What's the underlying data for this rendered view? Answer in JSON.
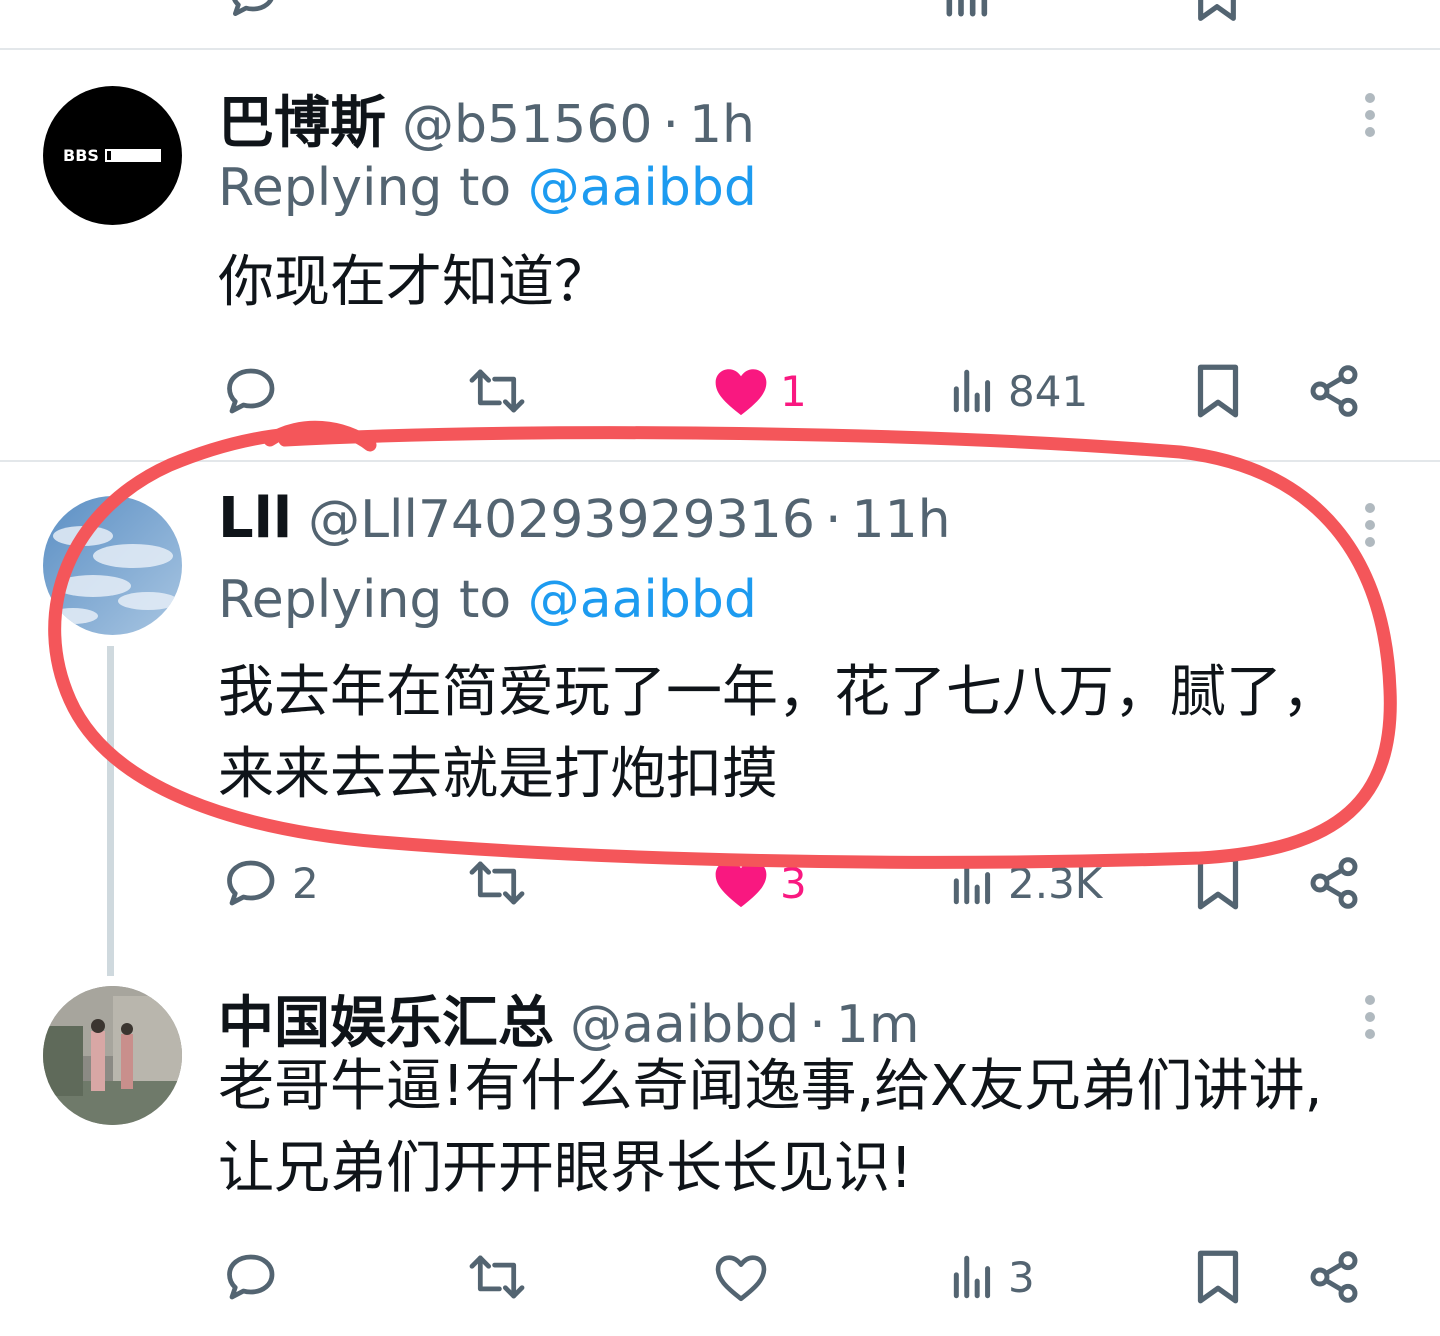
{
  "tweets": [
    {
      "name": "巴博斯",
      "handle": "@b51560",
      "time": "1h",
      "replying_prefix": "Replying to",
      "replying_handle": "@aaibbd",
      "text": "你现在才知道？",
      "likes": "1",
      "views": "841",
      "avatar_text": "BBS"
    },
    {
      "name": "Lll",
      "handle": "@Lll740293929316",
      "time": "11h",
      "replying_prefix": "Replying to",
      "replying_handle": "@aaibbd",
      "text": "我去年在简爱玩了一年，花了七八万，腻了，来来去去就是打炮扣摸",
      "replies": "2",
      "likes": "3",
      "views": "2.3K"
    },
    {
      "name": "中国娱乐汇总",
      "handle": "@aaibbd",
      "time": "1m",
      "text": "老哥牛逼!有什么奇闻逸事,给X友兄弟们讲讲,让兄弟们开开眼界长长见识!",
      "views": "3"
    }
  ],
  "colors": {
    "text": "#0f1419",
    "secondary": "#536471",
    "link": "#1d9bf0",
    "like": "#f91880",
    "annotation": "#f4565a"
  },
  "icons": [
    "reply-icon",
    "retweet-icon",
    "like-icon",
    "views-icon",
    "bookmark-icon",
    "share-icon",
    "more-icon"
  ]
}
